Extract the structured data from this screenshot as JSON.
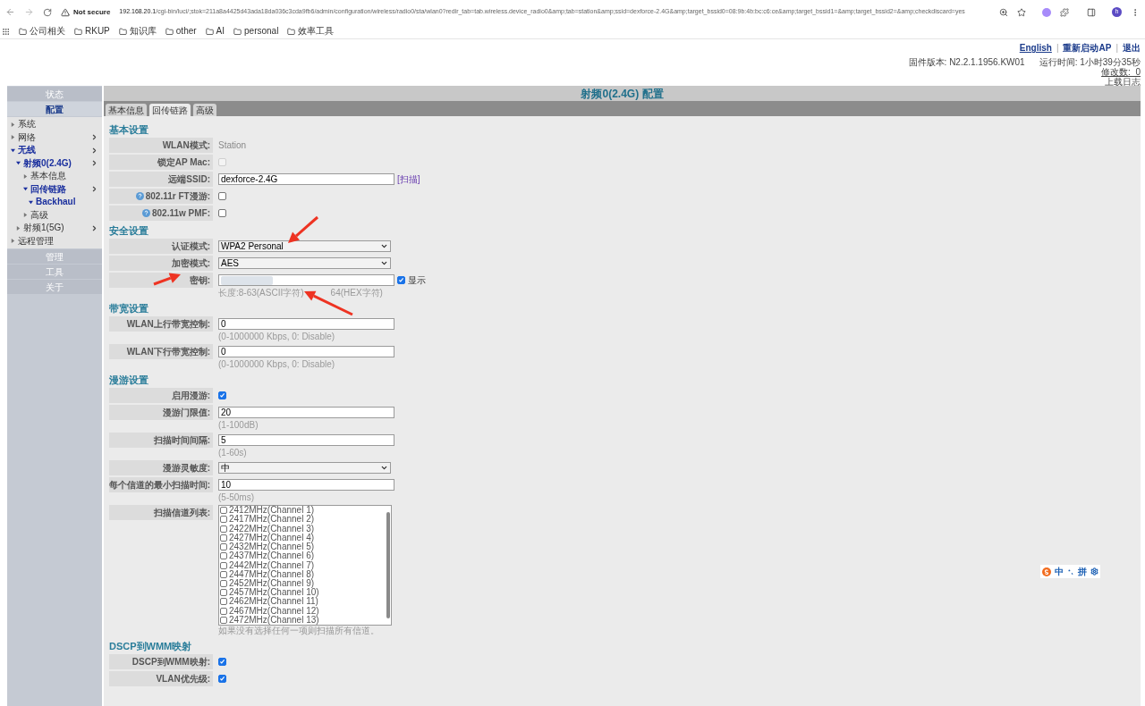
{
  "browser": {
    "security": "Not secure",
    "url_host": "192.168.20.1",
    "url_path": "/cgi-bin/luci/;stok=211a8a4425d43ada18da036c3cda9fb6/admin/configuration/wireless/radio0/sta/wlan0?redir_tab=tab.wireless.device_radio0&amp;tab=station&amp;ssid=dexforce-2.4G&amp;target_bssid0=08:9b:4b:bc:c6:ce&amp;target_bssid1=&amp;target_bssid2=&amp;checkdiscard=yes",
    "profile": "h",
    "bookmarks": [
      "公司相关",
      "RKUP",
      "知识库",
      "other",
      "AI",
      "personal",
      "效率工具"
    ]
  },
  "header": {
    "links": [
      "English",
      "重新启动AP",
      "退出"
    ],
    "separators": [
      "|",
      "|"
    ],
    "firmware_label": "固件版本:",
    "firmware": "N2.2.1.1956.KW01",
    "uptime_label": "运行时间:",
    "uptime": "1小时39分35秒",
    "changes": "修改数:  0",
    "log": "上载日志"
  },
  "sidebar": {
    "top": [
      {
        "label": "状态",
        "selected": false
      },
      {
        "label": "配置",
        "selected": true
      }
    ],
    "tree": [
      {
        "label": "系统",
        "expanded": false,
        "submenu": false
      },
      {
        "label": "网络",
        "expanded": false,
        "submenu": true
      },
      {
        "label": "无线",
        "expanded": true,
        "submenu": true,
        "children": [
          {
            "label": "射频0(2.4G)",
            "expanded": true,
            "submenu": true,
            "children": [
              {
                "label": "基本信息",
                "expanded": false,
                "submenu": false
              },
              {
                "label": "回传链路",
                "expanded": true,
                "submenu": true,
                "children": [
                  {
                    "label": "Backhaul",
                    "expanded": true,
                    "submenu": false
                  }
                ]
              },
              {
                "label": "高级",
                "expanded": false,
                "submenu": false
              }
            ]
          },
          {
            "label": "射频1(5G)",
            "expanded": false,
            "submenu": true
          }
        ]
      },
      {
        "label": "远程管理",
        "expanded": false,
        "submenu": false
      }
    ],
    "bottom": [
      {
        "label": "管理",
        "selected": false
      },
      {
        "label": "工具",
        "selected": false
      },
      {
        "label": "关于",
        "selected": false
      }
    ]
  },
  "page_title": "射频0(2.4G) 配置",
  "tabs": [
    {
      "label": "基本信息",
      "selected": false
    },
    {
      "label": "回传链路",
      "selected": true
    },
    {
      "label": "高级",
      "selected": false
    }
  ],
  "sections": [
    {
      "title": "基本设置",
      "fields": [
        {
          "kind": "text",
          "label": "WLAN模式:",
          "value": "Station"
        },
        {
          "kind": "checkbox",
          "label": "锁定AP Mac:",
          "checked": false,
          "disabled": true
        },
        {
          "kind": "input",
          "label": "远端SSID:",
          "value": "dexforce-2.4G",
          "link": "[扫描]"
        },
        {
          "kind": "checkbox",
          "label": "802.11r FT漫游:",
          "checked": false,
          "disabled": false,
          "help": true
        },
        {
          "kind": "checkbox",
          "label": "802.11w PMF:",
          "checked": false,
          "disabled": false,
          "help": true
        }
      ]
    },
    {
      "title": "安全设置",
      "fields": [
        {
          "kind": "select",
          "label": "认证模式:",
          "value": "WPA2 Personal"
        },
        {
          "kind": "select",
          "label": "加密模式:",
          "value": "AES"
        },
        {
          "kind": "password",
          "label": "密钥:",
          "show_label": "显示",
          "show": true,
          "hint_parts": [
            "长度:8-63(ASCII字符)",
            "64(HEX字符)"
          ]
        }
      ]
    },
    {
      "title": "带宽设置",
      "fields": [
        {
          "kind": "input",
          "label": "WLAN上行带宽控制:",
          "value": "0",
          "hint": "(0-1000000 Kbps, 0: Disable)"
        },
        {
          "kind": "input",
          "label": "WLAN下行带宽控制:",
          "value": "0",
          "hint": "(0-1000000 Kbps, 0: Disable)"
        }
      ]
    },
    {
      "title": "漫游设置",
      "fields": [
        {
          "kind": "checkbox",
          "label": "启用漫游:",
          "checked": true,
          "disabled": false
        },
        {
          "kind": "input",
          "label": "漫游门限值:",
          "value": "20",
          "hint": "(1-100dB)"
        },
        {
          "kind": "input",
          "label": "扫描时间间隔:",
          "value": "5",
          "hint": "(1-60s)"
        },
        {
          "kind": "select",
          "label": "漫游灵敏度:",
          "value": "中"
        },
        {
          "kind": "input",
          "label": "每个信道的最小扫描时间:",
          "value": "10",
          "hint": "(5-50ms)"
        },
        {
          "kind": "channel_list",
          "label": "扫描信道列表:",
          "hint": "如果没有选择任何一项则扫描所有信道。",
          "options": [
            {
              "label": "2412MHz(Channel 1)",
              "checked": false
            },
            {
              "label": "2417MHz(Channel 2)",
              "checked": false
            },
            {
              "label": "2422MHz(Channel 3)",
              "checked": false
            },
            {
              "label": "2427MHz(Channel 4)",
              "checked": false
            },
            {
              "label": "2432MHz(Channel 5)",
              "checked": false
            },
            {
              "label": "2437MHz(Channel 6)",
              "checked": false
            },
            {
              "label": "2442MHz(Channel 7)",
              "checked": false
            },
            {
              "label": "2447MHz(Channel 8)",
              "checked": false
            },
            {
              "label": "2452MHz(Channel 9)",
              "checked": false
            },
            {
              "label": "2457MHz(Channel 10)",
              "checked": false
            },
            {
              "label": "2462MHz(Channel 11)",
              "checked": false
            },
            {
              "label": "2467MHz(Channel 12)",
              "checked": false
            },
            {
              "label": "2472MHz(Channel 13)",
              "checked": false
            }
          ]
        }
      ]
    },
    {
      "title": "DSCP到WMM映射",
      "fields": [
        {
          "kind": "checkbox",
          "label": "DSCP到WMM映射:",
          "checked": true,
          "disabled": false
        },
        {
          "kind": "checkbox",
          "label": "VLAN优先级:",
          "checked": true,
          "disabled": false
        }
      ]
    }
  ],
  "ime": {
    "mode": "中",
    "input": "拼"
  }
}
